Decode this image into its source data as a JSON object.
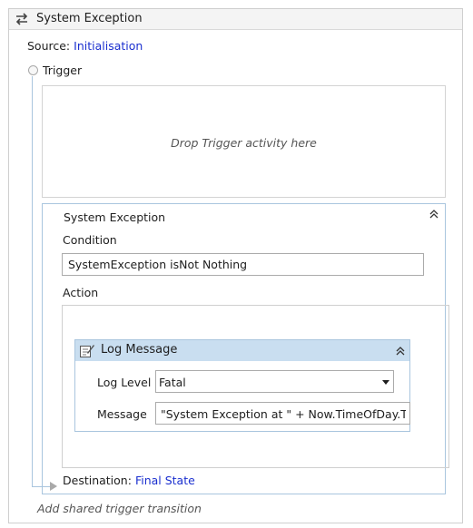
{
  "header": {
    "title": "System Exception"
  },
  "source": {
    "label": "Source:",
    "value": "Initialisation"
  },
  "trigger": {
    "label": "Trigger",
    "drop_hint": "Drop Trigger activity here"
  },
  "transition": {
    "title": "System Exception",
    "condition_label": "Condition",
    "condition_value": "SystemException isNot Nothing",
    "action_label": "Action",
    "activity": {
      "title": "Log Message",
      "log_level_label": "Log Level",
      "log_level_value": "Fatal",
      "message_label": "Message",
      "message_value": "\"System Exception at \" + Now.TimeOfDay.ToString"
    },
    "destination_label": "Destination:",
    "destination_value": "Final State"
  },
  "footer": {
    "add_transition": "Add shared trigger transition"
  },
  "colors": {
    "link": "#1a2fcf",
    "accent_border": "#a9c5de",
    "activity_header": "#c9def0"
  }
}
